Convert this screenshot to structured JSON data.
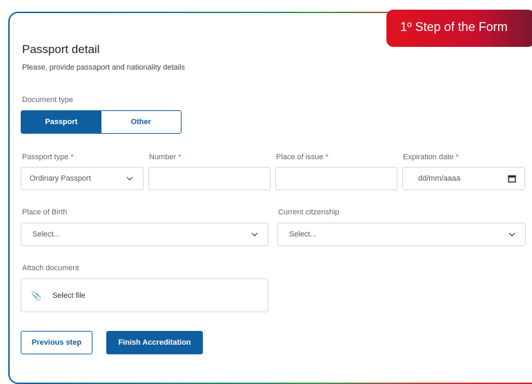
{
  "badge": "1º Step of the Form",
  "section": {
    "title": "Passport detail",
    "subtitle": "Please, provide passaport and nationality details"
  },
  "document_type": {
    "label": "Document type",
    "options": [
      "Passport",
      "Other"
    ],
    "selected": "Passport"
  },
  "fields": {
    "passport_type": {
      "label": "Passport type",
      "required_mark": "*",
      "value": "Ordinary Passport"
    },
    "number": {
      "label": "Number",
      "required_mark": "*",
      "value": ""
    },
    "place_of_issue": {
      "label": "Place of issue",
      "required_mark": "*",
      "value": ""
    },
    "expiration_date": {
      "label": "Expiration date",
      "required_mark": "*",
      "placeholder": "dd/mm/aaaa"
    },
    "place_of_birth": {
      "label": "Place of Birth",
      "placeholder": "Select..."
    },
    "current_citizenship": {
      "label": "Current citzenship",
      "placeholder": "Select..."
    },
    "attach_document": {
      "label": "Attach document",
      "button_label": "Select file"
    }
  },
  "actions": {
    "previous": "Previous step",
    "finish": "Finish Accreditation"
  },
  "colors": {
    "primary": "#0f5fa0",
    "badge": "#d0102a",
    "required": "#e34a4a"
  },
  "icons": [
    "chevron-down-icon",
    "calendar-icon",
    "paperclip-icon"
  ]
}
